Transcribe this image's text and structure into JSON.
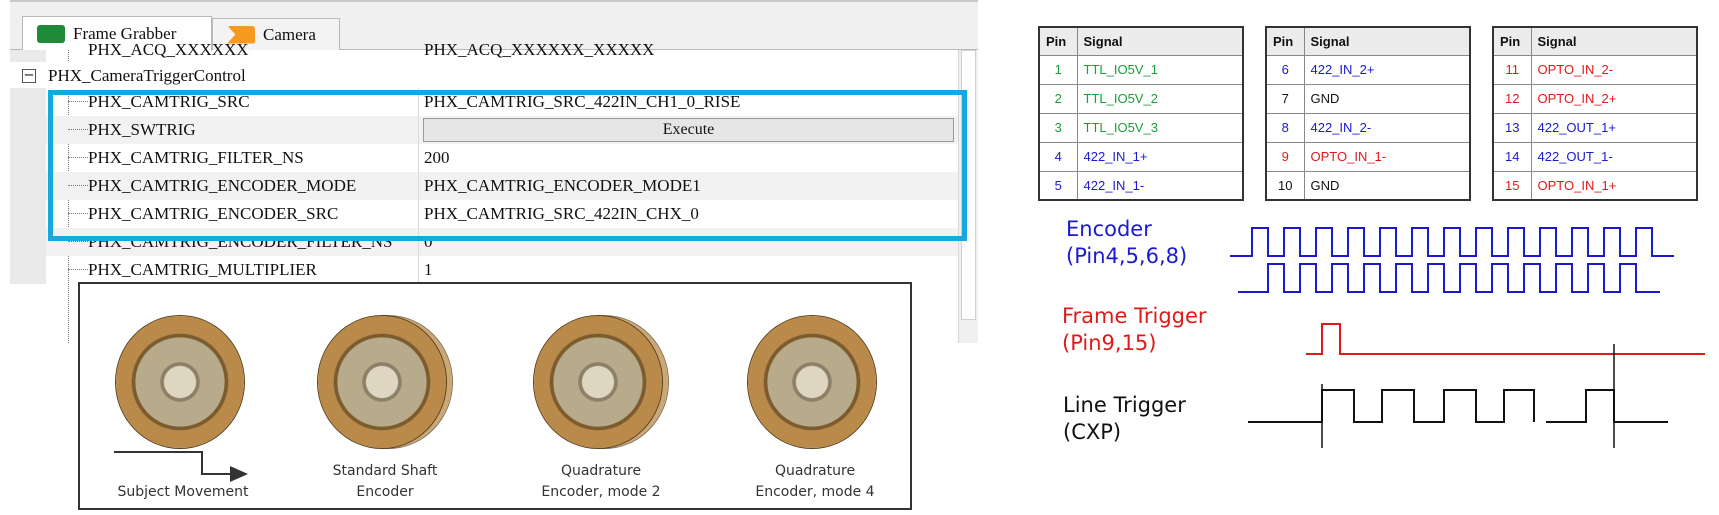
{
  "tabs": [
    {
      "label": "Frame Grabber",
      "icon": "frame-grabber-icon"
    },
    {
      "label": "Camera",
      "icon": "camera-icon"
    }
  ],
  "property_grid": {
    "cutoff_row": {
      "name": "PHX_ACQ_XXXXXX",
      "value": "PHX_ACQ_XXXXXX_XXXXX"
    },
    "group": {
      "name": "PHX_CameraTriggerControl",
      "expander": "−"
    },
    "rows": [
      {
        "name": "PHX_CAMTRIG_SRC",
        "value": "PHX_CAMTRIG_SRC_422IN_CH1_0_RISE"
      },
      {
        "name": "PHX_SWTRIG",
        "button": "Execute"
      },
      {
        "name": "PHX_CAMTRIG_FILTER_NS",
        "value": "200"
      },
      {
        "name": "PHX_CAMTRIG_ENCODER_MODE",
        "value": "PHX_CAMTRIG_ENCODER_MODE1"
      },
      {
        "name": "PHX_CAMTRIG_ENCODER_SRC",
        "value": "PHX_CAMTRIG_SRC_422IN_CHX_0"
      },
      {
        "name": "PHX_CAMTRIG_ENCODER_FILTER_NS",
        "value": "0"
      },
      {
        "name": "PHX_CAMTRIG_MULTIPLIER",
        "value": "1"
      }
    ],
    "highlight_color": "#18a8e0"
  },
  "encoder_panel": {
    "items": [
      {
        "caption_line1": "Subject Movement",
        "caption_line2": ""
      },
      {
        "caption_line1": "Standard Shaft",
        "caption_line2": "Encoder"
      },
      {
        "caption_line1": "Quadrature",
        "caption_line2": "Encoder, mode 2"
      },
      {
        "caption_line1": "Quadrature",
        "caption_line2": "Encoder, mode 4"
      }
    ]
  },
  "pin_tables": {
    "header": {
      "pin": "Pin",
      "signal": "Signal"
    },
    "tables": [
      [
        {
          "pin": "1",
          "signal": "TTL_IO5V_1",
          "color": "#1a9e3a"
        },
        {
          "pin": "2",
          "signal": "TTL_IO5V_2",
          "color": "#1a9e3a"
        },
        {
          "pin": "3",
          "signal": "TTL_IO5V_3",
          "color": "#1a9e3a"
        },
        {
          "pin": "4",
          "signal": "422_IN_1+",
          "color": "#1a1ad0"
        },
        {
          "pin": "5",
          "signal": "422_IN_1-",
          "color": "#1a1ad0"
        }
      ],
      [
        {
          "pin": "6",
          "signal": "422_IN_2+",
          "color": "#1a1ad0"
        },
        {
          "pin": "7",
          "signal": "GND",
          "color": "#111111"
        },
        {
          "pin": "8",
          "signal": "422_IN_2-",
          "color": "#1a1ad0"
        },
        {
          "pin": "9",
          "signal": "OPTO_IN_1-",
          "color": "#e01a1a"
        },
        {
          "pin": "10",
          "signal": "GND",
          "color": "#111111"
        }
      ],
      [
        {
          "pin": "11",
          "signal": "OPTO_IN_2-",
          "color": "#e01a1a"
        },
        {
          "pin": "12",
          "signal": "OPTO_IN_2+",
          "color": "#e01a1a"
        },
        {
          "pin": "13",
          "signal": "422_OUT_1+",
          "color": "#1a1ad0"
        },
        {
          "pin": "14",
          "signal": "422_OUT_1-",
          "color": "#1a1ad0"
        },
        {
          "pin": "15",
          "signal": "OPTO_IN_1+",
          "color": "#e01a1a"
        }
      ]
    ]
  },
  "timing": {
    "encoder": {
      "label_line1": "Encoder",
      "label_line2": "(Pin4,5,6,8)",
      "color": "#1a1ad0"
    },
    "frame_trigger": {
      "label_line1": "Frame Trigger",
      "label_line2": "(Pin9,15)",
      "color": "#e01a1a"
    },
    "line_trigger": {
      "label_line1": "Line Trigger",
      "label_line2": "(CXP)",
      "color": "#111111"
    }
  }
}
